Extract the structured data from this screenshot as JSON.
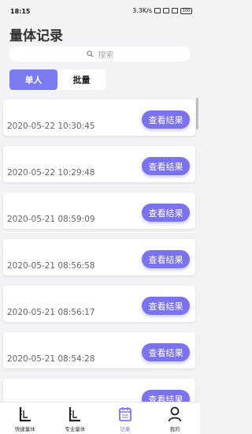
{
  "status_bar": {
    "time": "18:15",
    "network_speed": "3.3K/s",
    "battery": "100"
  },
  "page": {
    "title": "量体记录"
  },
  "search": {
    "placeholder": "搜索"
  },
  "tabs": [
    {
      "label": "单人",
      "active": true
    },
    {
      "label": "批量",
      "active": false
    }
  ],
  "records": [
    {
      "datetime": "2020-05-22 10:30:45",
      "action": "查看结果"
    },
    {
      "datetime": "2020-05-22 10:29:48",
      "action": "查看结果"
    },
    {
      "datetime": "2020-05-21 08:59:09",
      "action": "查看结果"
    },
    {
      "datetime": "2020-05-21 08:56:58",
      "action": "查看结果"
    },
    {
      "datetime": "2020-05-21 08:56:17",
      "action": "查看结果"
    },
    {
      "datetime": "2020-05-21 08:54:28",
      "action": "查看结果"
    },
    {
      "datetime": "",
      "action": "查看结果"
    }
  ],
  "bottom_nav": [
    {
      "label": "快捷量体",
      "icon": "ruler-square-icon",
      "active": false
    },
    {
      "label": "专业量体",
      "icon": "ruler-square-icon",
      "active": false
    },
    {
      "label": "记录",
      "icon": "calendar-icon",
      "active": true
    },
    {
      "label": "我的",
      "icon": "person-icon",
      "active": false
    }
  ],
  "colors": {
    "accent": "#7b73ee",
    "background": "#f3f3f6"
  }
}
